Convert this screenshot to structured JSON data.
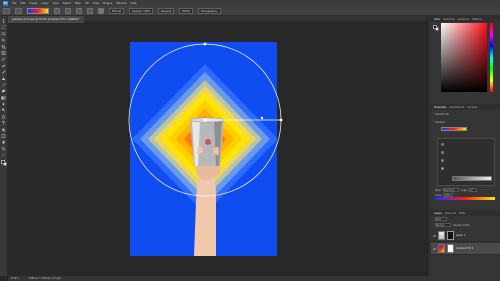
{
  "menubar": {
    "app_logo": "Ps",
    "items": [
      "File",
      "Edit",
      "Image",
      "Layer",
      "Type",
      "Select",
      "Filter",
      "3D",
      "View",
      "Plugins",
      "Window",
      "Help"
    ]
  },
  "options_bar": {
    "mode_label": "Normal",
    "opacity_label": "Opacity: 100%",
    "reverse_label": "Reverse",
    "dither_label": "Dither",
    "transparency_label": "Transparency"
  },
  "document": {
    "tab_title": "gradient_tool.psd @ 16.6% (Gradient Fill 1, RGB/8) *"
  },
  "status_bar": {
    "zoom": "16.6%",
    "doc_info": "1080 px x 1920 px (72 ppi)"
  },
  "panels": {
    "top_tabs": [
      "Color",
      "Swatches",
      "Gradients",
      "Patterns"
    ],
    "properties_tabs": [
      "Properties",
      "Adjustments",
      "Libraries"
    ],
    "properties_title": "Gradient Fill",
    "gradient_label": "Gradient",
    "style_label": "Style",
    "style_value": "Diamond",
    "angle_label": "Angle",
    "angle_value": "0°",
    "scale_label": "Scale",
    "scale_value": "100%",
    "layers_tabs": [
      "Layers",
      "Channels",
      "Paths"
    ],
    "kind_label": "Kind",
    "blend_mode": "Normal",
    "opacity_label": "Opacity: 100%",
    "layers": [
      {
        "name": "Layer 1"
      },
      {
        "name": "Gradient Fill 1"
      }
    ]
  },
  "colors": {
    "canvas_blue": "#0f4df0",
    "gradient_red": "#ff1b1b",
    "gradient_yellow": "#ffe600",
    "ui_dark": "#262626"
  }
}
